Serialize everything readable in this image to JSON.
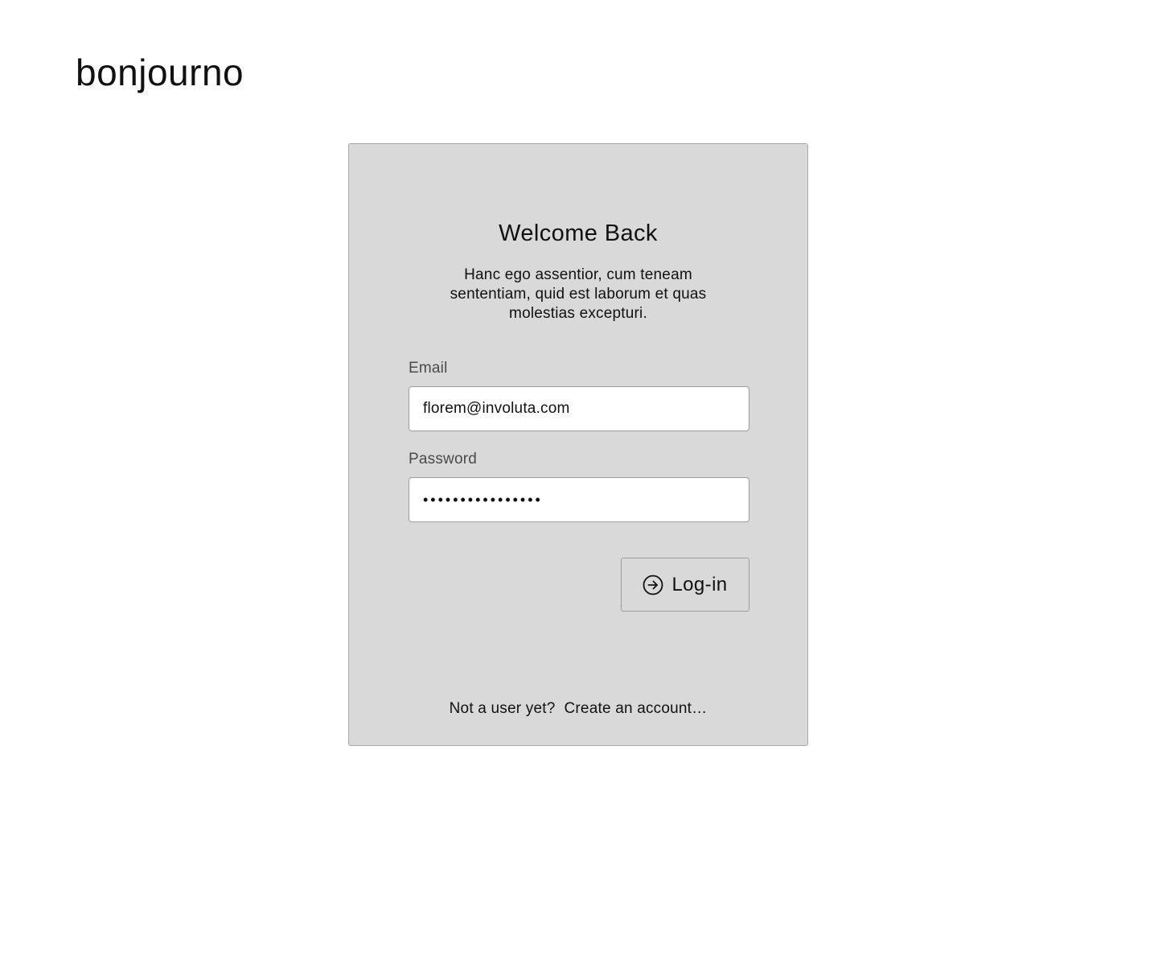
{
  "brand": {
    "name": "bonjourno"
  },
  "login_card": {
    "title": "Welcome Back",
    "subtitle": "Hanc ego assentior, cum teneam sententiam, quid est laborum et quas molestias excepturi.",
    "email": {
      "label": "Email",
      "value": "florem@involuta.com"
    },
    "password": {
      "label": "Password",
      "value": "••••••••••••••••"
    },
    "login_button": {
      "label": "Log-in",
      "icon": "arrow-right-circle-icon"
    },
    "signup": {
      "prompt": "Not a user yet?",
      "link": "Create an account…"
    }
  },
  "colors": {
    "page_background": "#ffffff",
    "card_background": "#d9d9d9",
    "card_border": "#a8a8a8",
    "label_text": "#4a4a4a",
    "primary_text": "#111111"
  }
}
